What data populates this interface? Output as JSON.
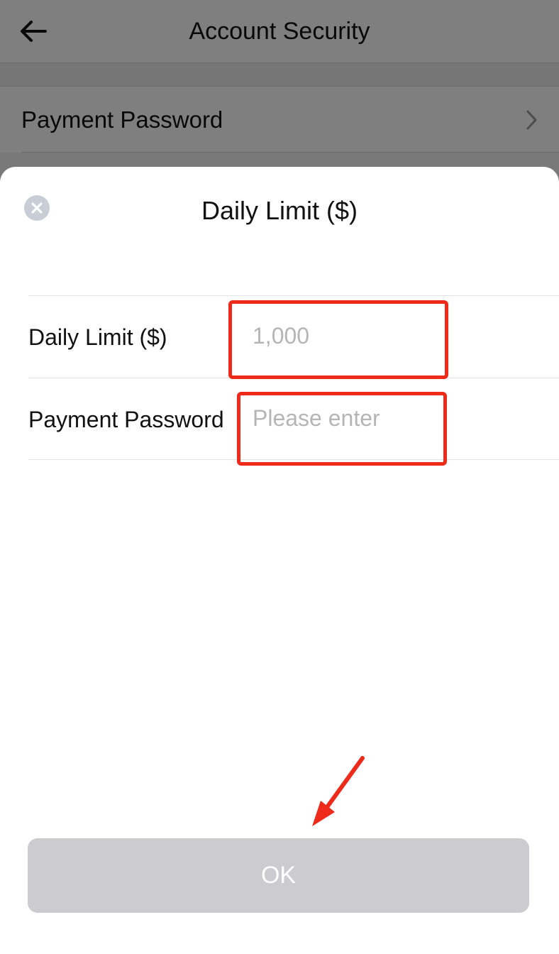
{
  "background_page": {
    "title": "Account Security",
    "back_icon": "arrow-left-icon",
    "rows": [
      {
        "label": "Payment Password",
        "icon": "chevron-right-icon"
      }
    ]
  },
  "sheet": {
    "title": "Daily Limit ($)",
    "close_icon": "close-circle-icon",
    "fields": [
      {
        "label": "Daily Limit ($)",
        "value": "",
        "placeholder": "1,000"
      },
      {
        "label": "Payment Password",
        "value": "",
        "placeholder": "Please enter"
      }
    ],
    "ok_label": "OK"
  },
  "colors": {
    "annotation": "#ee2a1b",
    "button_disabled": "#cbcbd0",
    "placeholder": "#b5b5b5"
  }
}
